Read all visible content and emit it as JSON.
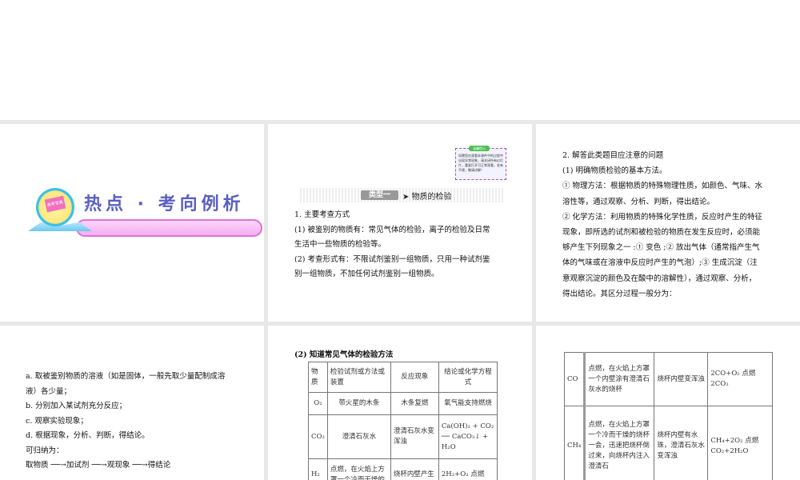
{
  "slide1": {
    "title": "热点 · 考向例析",
    "badge_text": "高考宝典"
  },
  "slide2": {
    "note_title": "温馨提示",
    "note_body": "如需您在观看本课件中的过程中出现异常现象，请关闭所有幻灯片，重复打开可正常观看，若有不便，敬请谅解！",
    "type_tag": "类型一",
    "type_label": "➤ 物质的检验",
    "lines": [
      "1. 主要考查方式",
      "(1) 被鉴别的物质有：常见气体的检验，离子的检验及日常",
      "生活中一些物质的检验等。",
      "(2) 考查形式有：不限试剂鉴别一组物质，只用一种试剂鉴",
      "别一组物质，不加任何试剂鉴别一组物质。"
    ]
  },
  "slide3": {
    "lines": [
      "2. 解答此类题目应注意的问题",
      "(1) 明确物质检验的基本方法。",
      "① 物理方法：根据物质的特殊物理性质，如颜色、气味、水",
      "溶性等，通过观察、分析、判断，得出结论。",
      "② 化学方法：利用物质的特殊化学性质，反应时产生的特征",
      "现象，即所选的试剂和被检验的物质在发生反应时，必须能",
      "够产生下列现象之一 :① 变色 ;② 放出气体（通常指产生气",
      "体的气味或在溶液中反应时产生的气泡）;③ 生成沉淀（注",
      "意观察沉淀的颜色及在酸中的溶解性），通过观察、分析，",
      "得出结论。其区分过程一般分为："
    ]
  },
  "slide4": {
    "lines": [
      "a. 取被鉴别物质的溶液（如是固体，一般先取少量配制成溶",
      "液）各少量；",
      "b. 分别加入某试剂充分反应；",
      "c. 观察实验现象；",
      "d. 根据现象，分析、判断，得结论。",
      "可归纳为：",
      "取物质 ──→加试剂 ──→观现象 ──→得结论"
    ]
  },
  "slide5": {
    "heading": "(2) 知道常见气体的检验方法",
    "headers": [
      "物质",
      "检验试剂或方法或装置",
      "反应现象",
      "结论或化学方程式"
    ],
    "rows": [
      [
        "O₂",
        "带火星的木条",
        "木条复燃",
        "氧气能支持燃烧"
      ],
      [
        "CO₂",
        "澄清石灰水",
        "澄清石灰水变浑浊",
        "Ca(OH)₂ + CO₂ ── CaCO₃↓ + H₂O"
      ],
      [
        "H₂",
        "点燃，在火焰上方罩一个冷而干燥的",
        "烧杯内壁产生",
        "2H₂+O₂ 点燃"
      ]
    ]
  },
  "slide6": {
    "rows": [
      [
        "CO",
        "点燃，在火焰上方罩一个内壁涂有澄清石灰水的烧杯",
        "烧杯内壁变浑浊",
        "2CO+O₂ 点燃 2CO₂"
      ],
      [
        "CH₄",
        "点燃，在火焰上方罩一个冷而干燥的烧杯一会，迅速把烧杯倒过来，向烧杯内注入澄清石",
        "烧杯内壁有水珠，澄清石灰水变浑浊",
        "CH₄+2O₂ 点燃 CO₂+2H₂O"
      ]
    ]
  }
}
